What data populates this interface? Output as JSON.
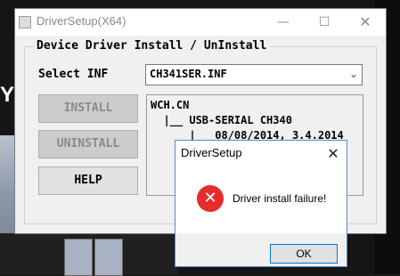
{
  "main_window": {
    "title": "DriverSetup(X64)",
    "minimize_glyph": "—",
    "maximize_glyph": "☐",
    "close_glyph": "✕",
    "group_label": "Device Driver Install / UnInstall",
    "select_label": "Select INF",
    "inf_selected": "CH341SER.INF",
    "dropdown_glyph": "⌄",
    "buttons": {
      "install": "INSTALL",
      "uninstall": "UNINSTALL",
      "help": "HELP"
    },
    "tree": {
      "line1": "WCH.CN",
      "line2": "  |__ USB-SERIAL CH340",
      "line3": "      |__ 08/08/2014, 3.4.2014"
    }
  },
  "dialog": {
    "title": "DriverSetup",
    "close_glyph": "✕",
    "icon": "error-icon",
    "icon_glyph": "✕",
    "message": "Driver install failure!",
    "ok_label": "OK"
  },
  "background": {
    "left_text": "Y P"
  },
  "colors": {
    "error_red": "#e52d2d",
    "accent_blue": "#0078d7"
  }
}
